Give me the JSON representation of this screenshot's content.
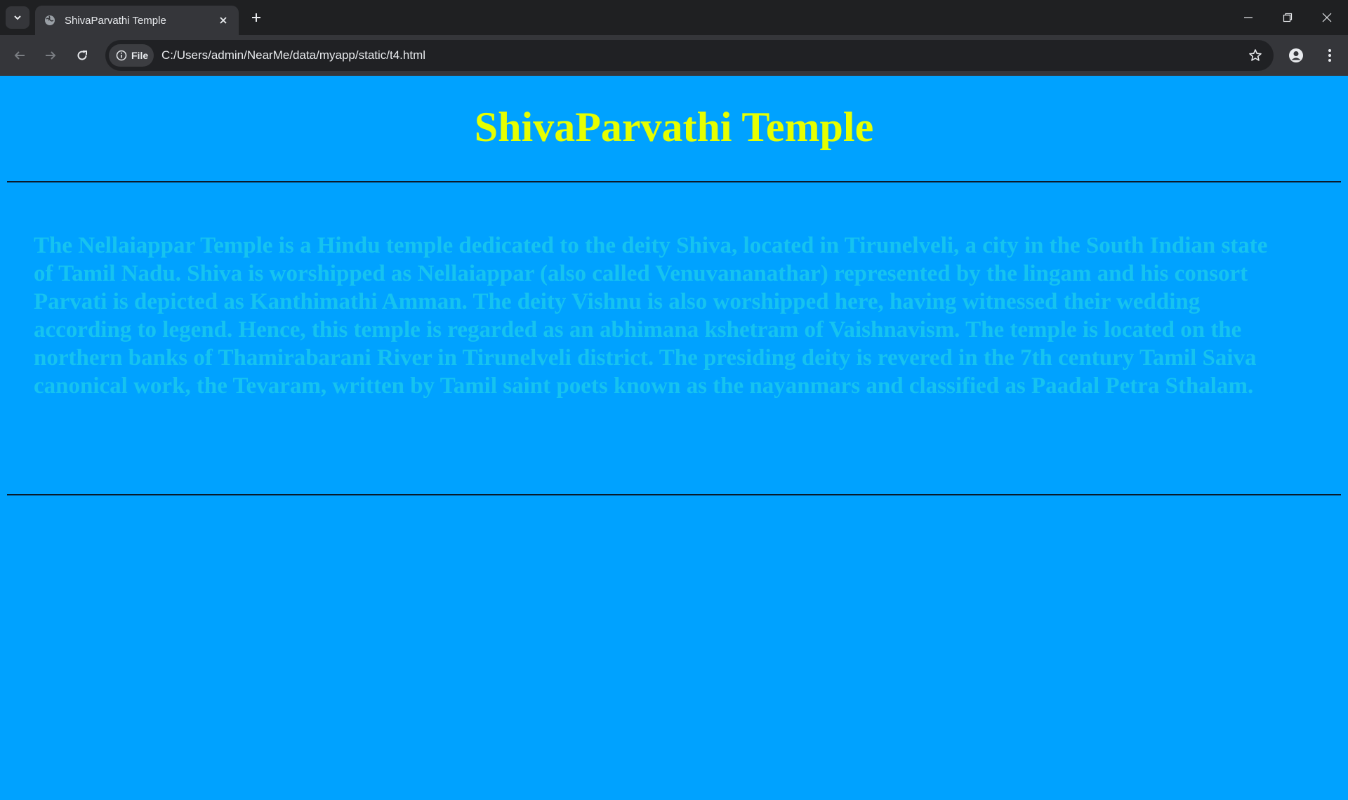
{
  "browser": {
    "tab_title": "ShivaParvathi Temple",
    "url": "C:/Users/admin/NearMe/data/myapp/static/t4.html",
    "security_chip_label": "File",
    "icons": {
      "tab_search": "chevron-down-icon",
      "favicon": "globe-icon",
      "tab_close": "close-icon",
      "new_tab": "plus-icon",
      "minimize": "minimize-icon",
      "restore": "restore-icon",
      "close_window": "close-icon",
      "back": "arrow-left-icon",
      "forward": "arrow-right-icon",
      "reload": "reload-icon",
      "site_info": "info-icon",
      "bookmark": "star-icon",
      "profile": "person-icon",
      "menu": "kebab-menu-icon"
    },
    "colors": {
      "tabstrip": "#1f2022",
      "toolbar": "#35363a",
      "omnibox": "#202124"
    }
  },
  "page": {
    "heading": "ShivaParvathi Temple",
    "paragraph": "The Nellaiappar Temple is a Hindu temple dedicated to the deity Shiva, located in Tirunelveli, a city in the South Indian state of Tamil Nadu. Shiva is worshipped as Nellaiappar (also called Venuvananathar) represented by the lingam and his consort Parvati is depicted as Kanthimathi Amman. The deity Vishnu is also worshipped here, having witnessed their wedding according to legend. Hence, this temple is regarded as an abhimana kshetram of Vaishnavism. The temple is located on the northern banks of Thamirabarani River in Tirunelveli district. The presiding deity is revered in the 7th century Tamil Saiva canonical work, the Tevaram, written by Tamil saint poets known as the nayanmars and classified as Paadal Petra Sthalam.",
    "colors": {
      "background": "#00a2ff",
      "heading": "#e6ff00",
      "paragraph": "#16c3f0",
      "rule": "#0a1a2a"
    }
  }
}
